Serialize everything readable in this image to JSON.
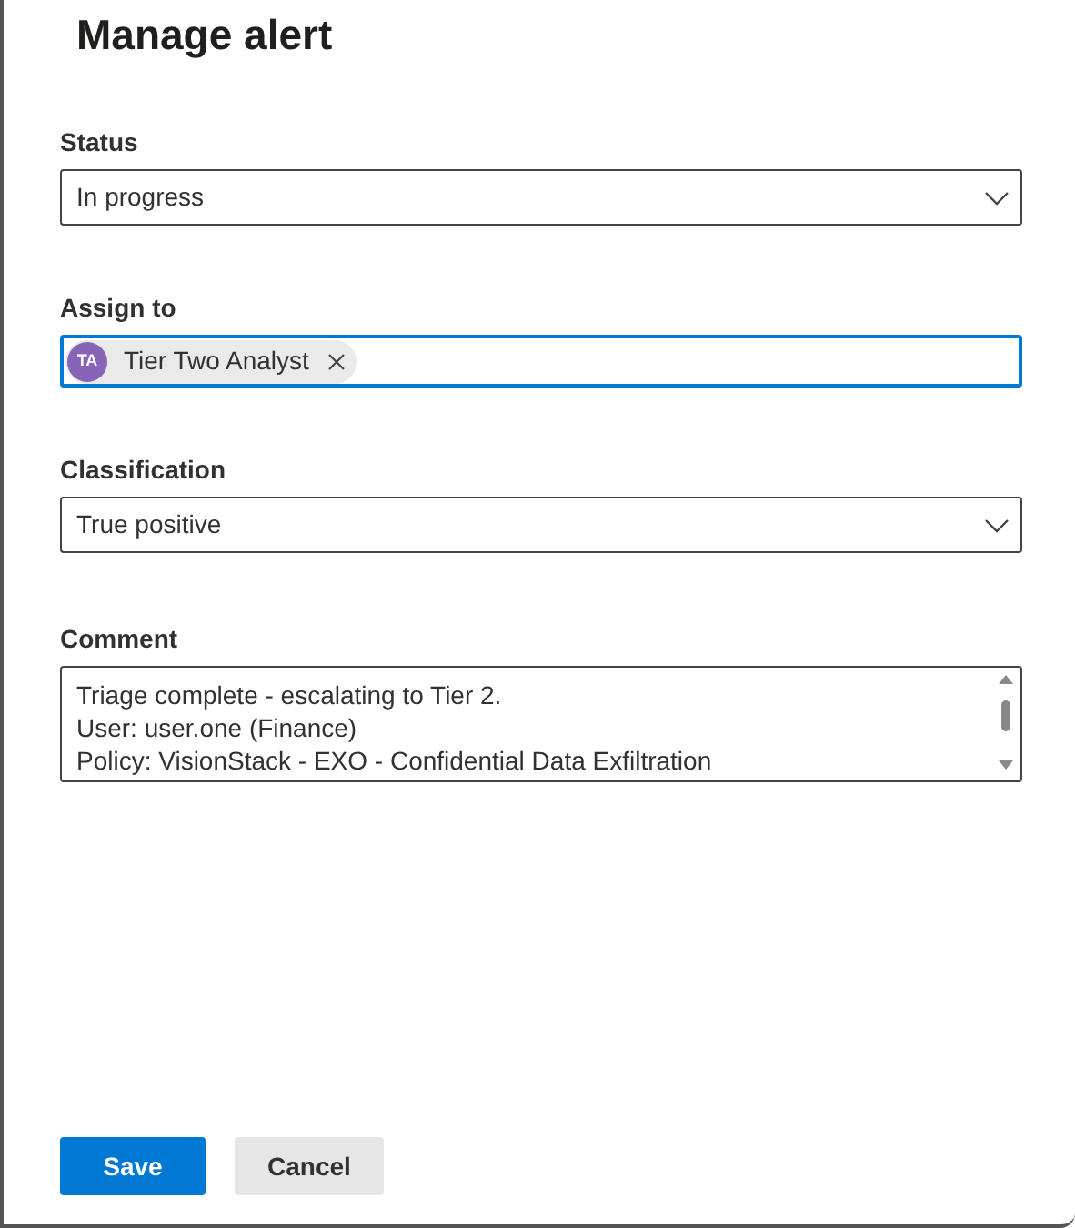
{
  "title": "Manage alert",
  "fields": [
    {
      "kind": "dropdown",
      "label": "Status",
      "value": "In progress"
    },
    {
      "kind": "people",
      "label": "Assign to",
      "focused": true,
      "people": [
        {
          "initials": "TA",
          "name": "Tier Two Analyst",
          "color": "#8764b8"
        }
      ]
    },
    {
      "kind": "dropdown",
      "label": "Classification",
      "value": "True positive"
    },
    {
      "kind": "textarea",
      "label": "Comment",
      "lines": [
        "Triage complete - escalating to Tier 2.",
        "User: user.one (Finance)",
        "Policy: VisionStack - EXO - Confidential Data Exfiltration"
      ]
    }
  ],
  "buttons": [
    {
      "label": "Save",
      "kind": "primary"
    },
    {
      "label": "Cancel",
      "kind": "secondary"
    }
  ]
}
